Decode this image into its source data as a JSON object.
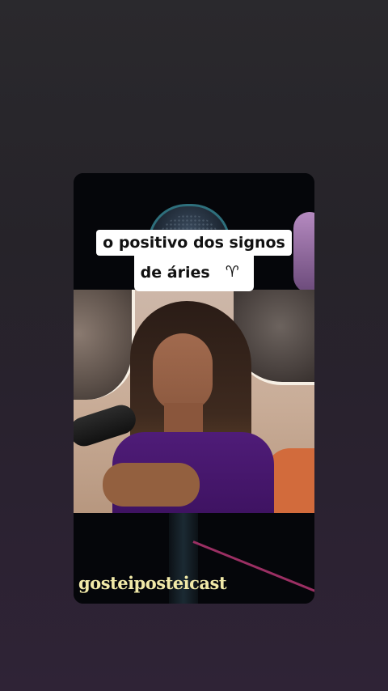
{
  "video": {
    "caption_line1": "o positivo dos signos",
    "caption_line2": "de áries",
    "caption_icon": "aries-zodiac-icon",
    "caption_icon_glyph": "♈",
    "watermark": "gosteiposteicast",
    "colors": {
      "background": "#2a2630",
      "caption_bg": "#ffffff",
      "caption_text": "#111111",
      "aries_badge": "#ce2f4a",
      "dress": "#4f1c78",
      "chair": "#d26b3c",
      "watermark": "#f1e9a8"
    }
  }
}
